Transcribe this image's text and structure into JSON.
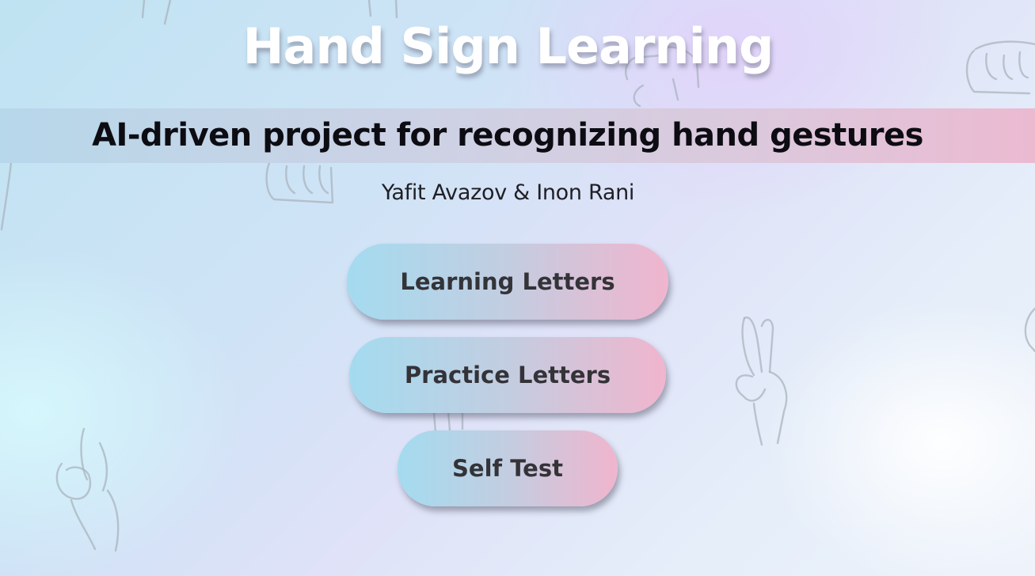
{
  "header": {
    "title": "Hand Sign Learning",
    "subtitle": "AI-driven project for recognizing hand gestures",
    "authors": "Yafit Avazov & Inon Rani"
  },
  "menu": {
    "learning_label": "Learning Letters",
    "practice_label": "Practice Letters",
    "test_label": "Self Test"
  },
  "colors": {
    "button_gradient_start": "#a4dbef",
    "button_gradient_end": "#f0b5cd",
    "banner_start": "#b7d7ea",
    "banner_end": "#ebbad1",
    "title_text": "#ffffff"
  }
}
